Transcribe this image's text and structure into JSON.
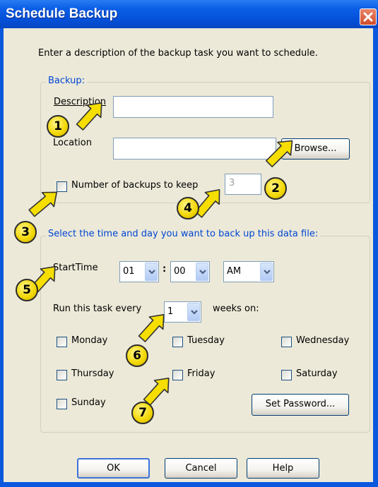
{
  "window": {
    "title": "Schedule Backup"
  },
  "intro_text": "Enter a description of the backup task you want to schedule.",
  "backup_group": {
    "title": "Backup:",
    "description_label": "Description",
    "description_value": "",
    "location_label": "Location",
    "location_value": "",
    "browse_label": "Browse...",
    "keep_label": "Number of backups to keep",
    "keep_checked": false,
    "keep_value": "3"
  },
  "schedule_group": {
    "title": "Select the time and day you want to back up this data file:",
    "start_time_label": "StartTime",
    "hour": "01",
    "time_separator": ":",
    "minute": "00",
    "ampm": "AM",
    "run_every_label": "Run this task every",
    "weeks_value": "1",
    "weeks_on_label": "weeks on:",
    "days": [
      {
        "label": "Monday",
        "checked": false
      },
      {
        "label": "Tuesday",
        "checked": false
      },
      {
        "label": "Wednesday",
        "checked": false
      },
      {
        "label": "Thursday",
        "checked": false
      },
      {
        "label": "Friday",
        "checked": false
      },
      {
        "label": "Saturday",
        "checked": false
      },
      {
        "label": "Sunday",
        "checked": false
      }
    ],
    "set_password_label": "Set Password..."
  },
  "buttons": {
    "ok": "OK",
    "cancel": "Cancel",
    "help": "Help"
  },
  "callouts": [
    "1",
    "2",
    "3",
    "4",
    "5",
    "6",
    "7"
  ],
  "colors": {
    "title_bar": "#0a5fe6",
    "dialog_bg": "#ece9d8",
    "group_title": "#0046d5",
    "callout_fill": "#f2d600",
    "close_button": "#d24d2a"
  },
  "icons": {
    "close": "close-x-icon",
    "dropdown": "chevron-down-icon",
    "annotation": "yellow-arrow-icon"
  }
}
